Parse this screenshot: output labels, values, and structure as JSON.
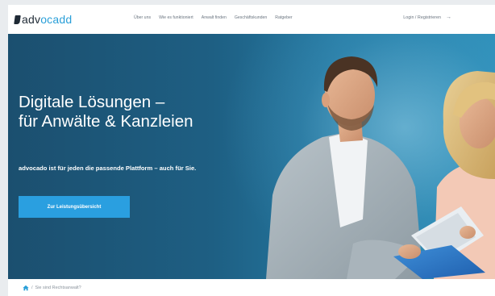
{
  "brand": {
    "logo_part1": "adv",
    "logo_part2": "ocadd",
    "accent": "#2a9fd8",
    "dark": "#1f2a35"
  },
  "nav": {
    "items": [
      {
        "label": "Über uns"
      },
      {
        "label": "Wie es funktioniert"
      },
      {
        "label": "Anwalt finden"
      },
      {
        "label": "Geschäftskunden"
      },
      {
        "label": "Ratgeber"
      }
    ],
    "login_label": "Login / Registrieren",
    "login_icon": "arrow-right-icon"
  },
  "hero": {
    "title_line1": "Digitale Lösungen –",
    "title_line2": "für Anwälte & Kanzleien",
    "subtitle": "advocado ist für jeden die passende Plattform – auch für Sie.",
    "cta_label": "Zur Leistungsübersicht",
    "cta_color": "#2a9fe0"
  },
  "breadcrumb": {
    "home_icon": "home-icon",
    "separator": "/",
    "current": "Sie sind Rechtsanwalt?"
  }
}
